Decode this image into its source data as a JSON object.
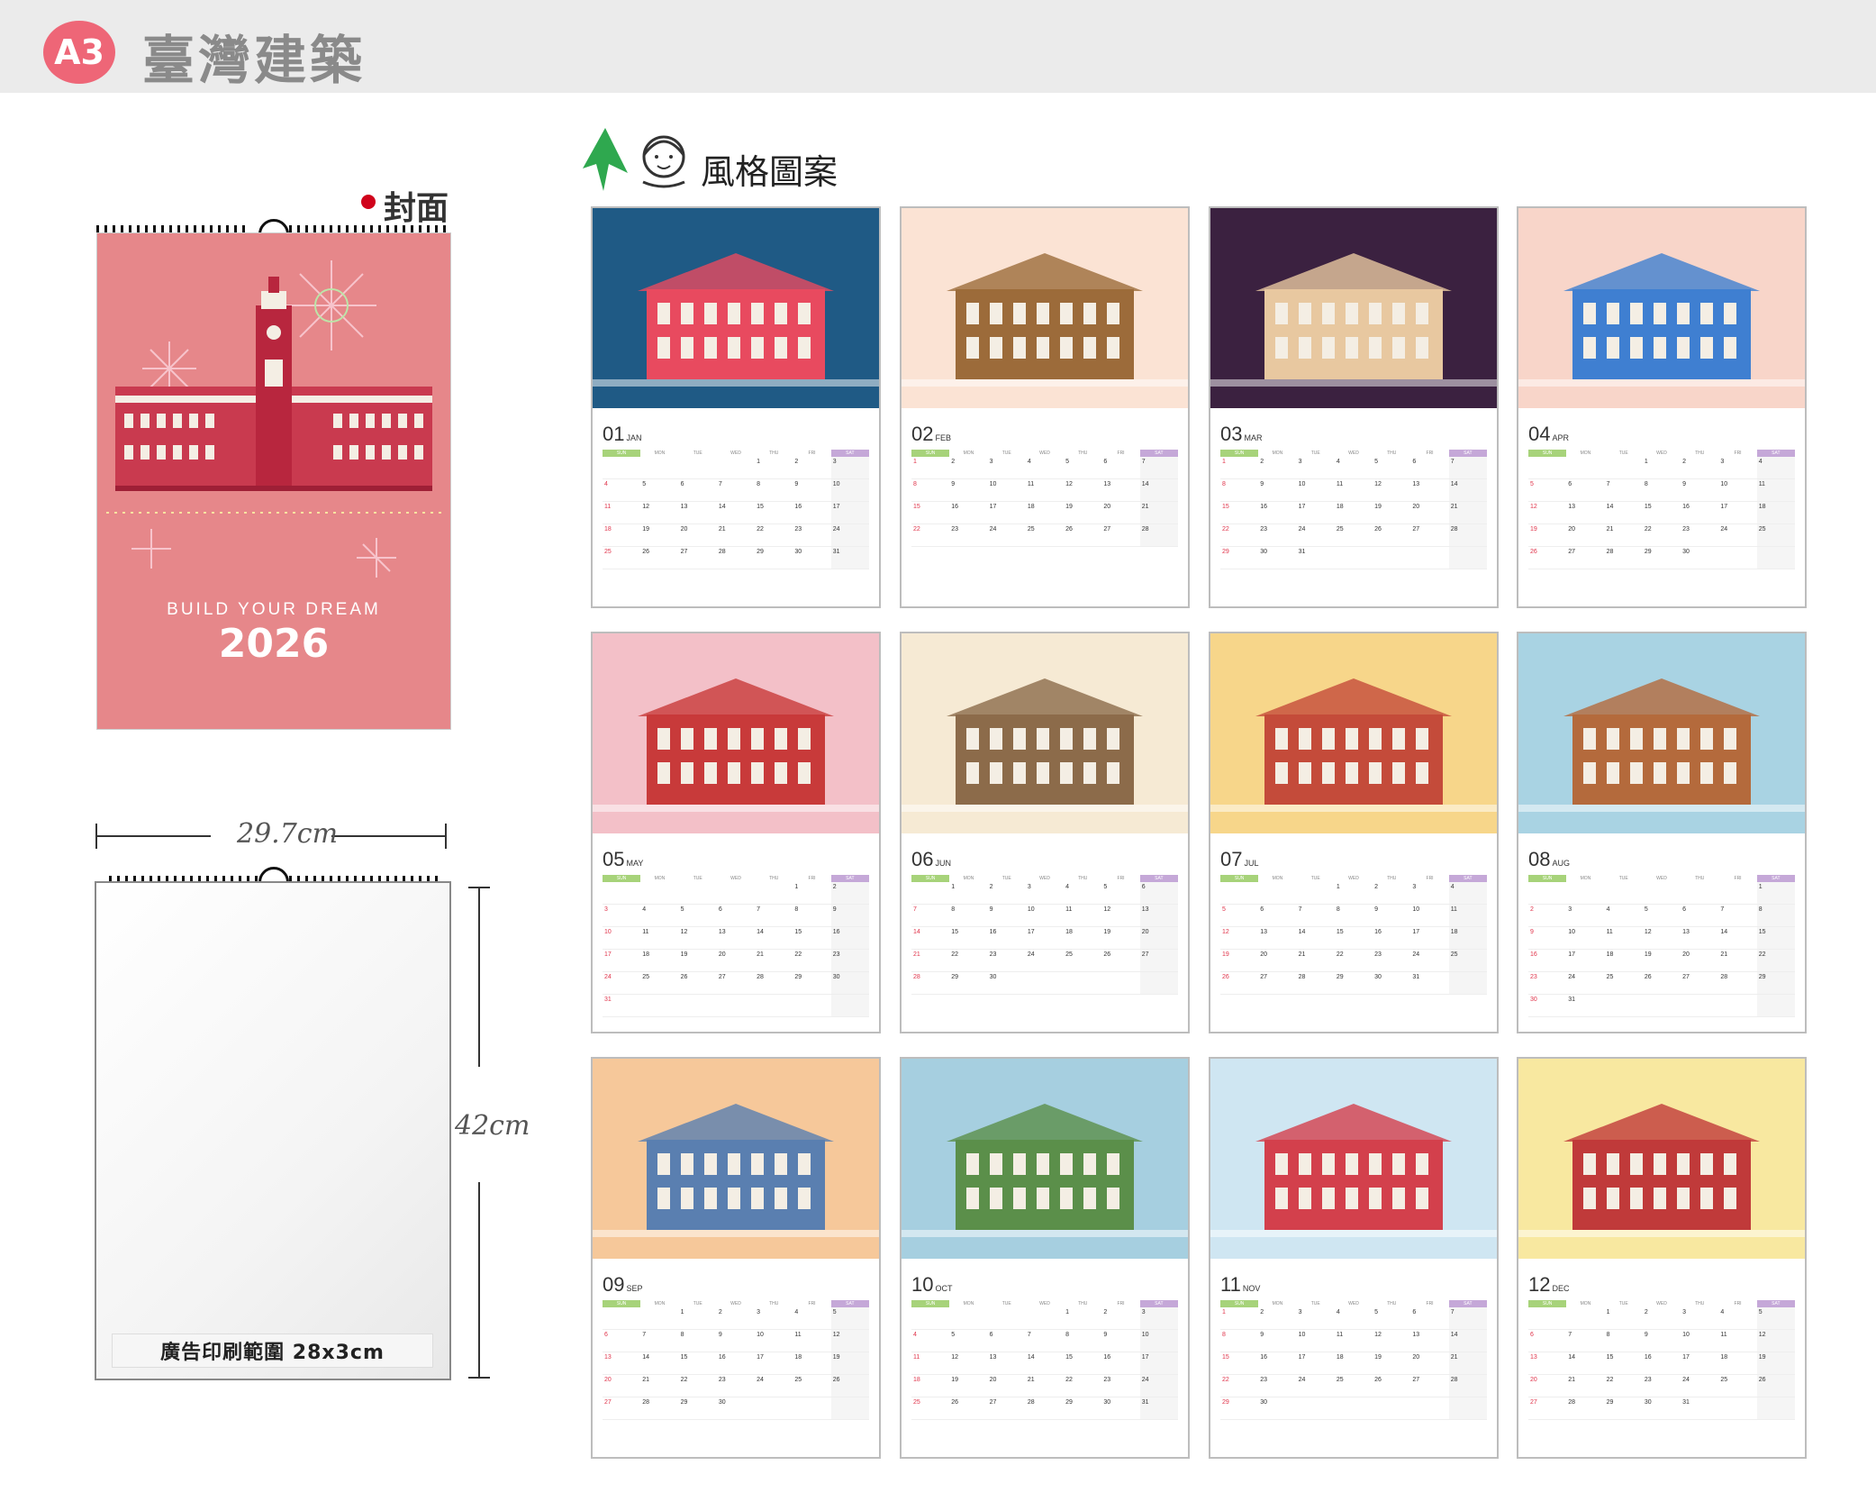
{
  "header": {
    "badge": "A3",
    "title": "臺灣建築"
  },
  "cover": {
    "label": "封面",
    "slogan": "BUILD YOUR DREAM",
    "year": "2026"
  },
  "dimensions": {
    "width": "29.7cm",
    "height": "42cm",
    "ad_band": "廣告印刷範圍 28x3cm"
  },
  "style_section": {
    "label": "風格圖案"
  },
  "weekdays": [
    "SUN",
    "MON",
    "TUE",
    "WED",
    "THU",
    "FRI",
    "SAT"
  ],
  "months": [
    {
      "num": "01",
      "abbr": "JAN",
      "start": 4,
      "days": 31,
      "bg": "#1f5a85",
      "accent": "#e84a5f"
    },
    {
      "num": "02",
      "abbr": "FEB",
      "start": 0,
      "days": 28,
      "bg": "#fbe3d4",
      "accent": "#9c6b3a"
    },
    {
      "num": "03",
      "abbr": "MAR",
      "start": 0,
      "days": 31,
      "bg": "#3b2140",
      "accent": "#e8c8a0"
    },
    {
      "num": "04",
      "abbr": "APR",
      "start": 3,
      "days": 30,
      "bg": "#f8d5c9",
      "accent": "#3f7fd1"
    },
    {
      "num": "05",
      "abbr": "MAY",
      "start": 5,
      "days": 31,
      "bg": "#f3c0c8",
      "accent": "#c83a3a"
    },
    {
      "num": "06",
      "abbr": "JUN",
      "start": 1,
      "days": 30,
      "bg": "#f6ead4",
      "accent": "#8c6b4a"
    },
    {
      "num": "07",
      "abbr": "JUL",
      "start": 3,
      "days": 31,
      "bg": "#f7d68a",
      "accent": "#c44b3a"
    },
    {
      "num": "08",
      "abbr": "AUG",
      "start": 6,
      "days": 31,
      "bg": "#a9d3e3",
      "accent": "#b46a3c"
    },
    {
      "num": "09",
      "abbr": "SEP",
      "start": 2,
      "days": 30,
      "bg": "#f6c89a",
      "accent": "#5a7fb0"
    },
    {
      "num": "10",
      "abbr": "OCT",
      "start": 4,
      "days": 31,
      "bg": "#a6cfe0",
      "accent": "#5b8f4a"
    },
    {
      "num": "11",
      "abbr": "NOV",
      "start": 0,
      "days": 30,
      "bg": "#cfe6f2",
      "accent": "#d3404c"
    },
    {
      "num": "12",
      "abbr": "DEC",
      "start": 2,
      "days": 31,
      "bg": "#f8e8a0",
      "accent": "#c03a3a"
    }
  ]
}
